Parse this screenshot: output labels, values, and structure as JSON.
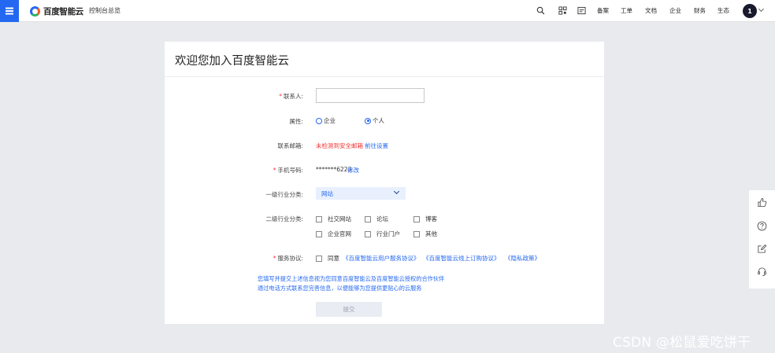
{
  "header": {
    "brand": "百度智能云",
    "console_link": "控制台总览",
    "nav": [
      "备案",
      "工单",
      "文档",
      "企业",
      "财务",
      "生态"
    ],
    "avatar_initial": "1",
    "accent_color": "#2468f2"
  },
  "form": {
    "title": "欢迎您加入百度智能云",
    "contact": {
      "label": "联系人:",
      "required": "*",
      "value": "",
      "placeholder": ""
    },
    "attribute": {
      "label": "属性:",
      "options": [
        "企业",
        "个人"
      ],
      "selected": "个人"
    },
    "email": {
      "label": "联系邮箱:",
      "status": "未检测到安全邮箱",
      "action": "前往设置"
    },
    "phone": {
      "label": "手机号码:",
      "required": "*",
      "value": "*******6223",
      "action": "修改"
    },
    "industry1": {
      "label": "一级行业分类:",
      "selected": "网站"
    },
    "industry2": {
      "label": "二级行业分类:",
      "options": [
        "社交网站",
        "论坛",
        "博客",
        "企业官网",
        "行业门户",
        "其他"
      ]
    },
    "agreement": {
      "label": "服务协议:",
      "required": "*",
      "agree_text": "同意",
      "links": [
        "《百度智能云用户服务协议》",
        "《百度智能云线上订购协议》",
        "《隐私政策》"
      ]
    },
    "notice_line1": "您填写并提交上述信息视为您同意百度智能云及百度智能云授权的合作伙伴",
    "notice_line2": "通过电话方式联系您完善信息，以便能够为您提供更贴心的云服务",
    "submit_label": "提交"
  },
  "float_toolbar": [
    "thumbs-up-icon",
    "help-icon",
    "edit-icon",
    "headset-icon"
  ],
  "watermark": "CSDN @松鼠爱吃饼干"
}
